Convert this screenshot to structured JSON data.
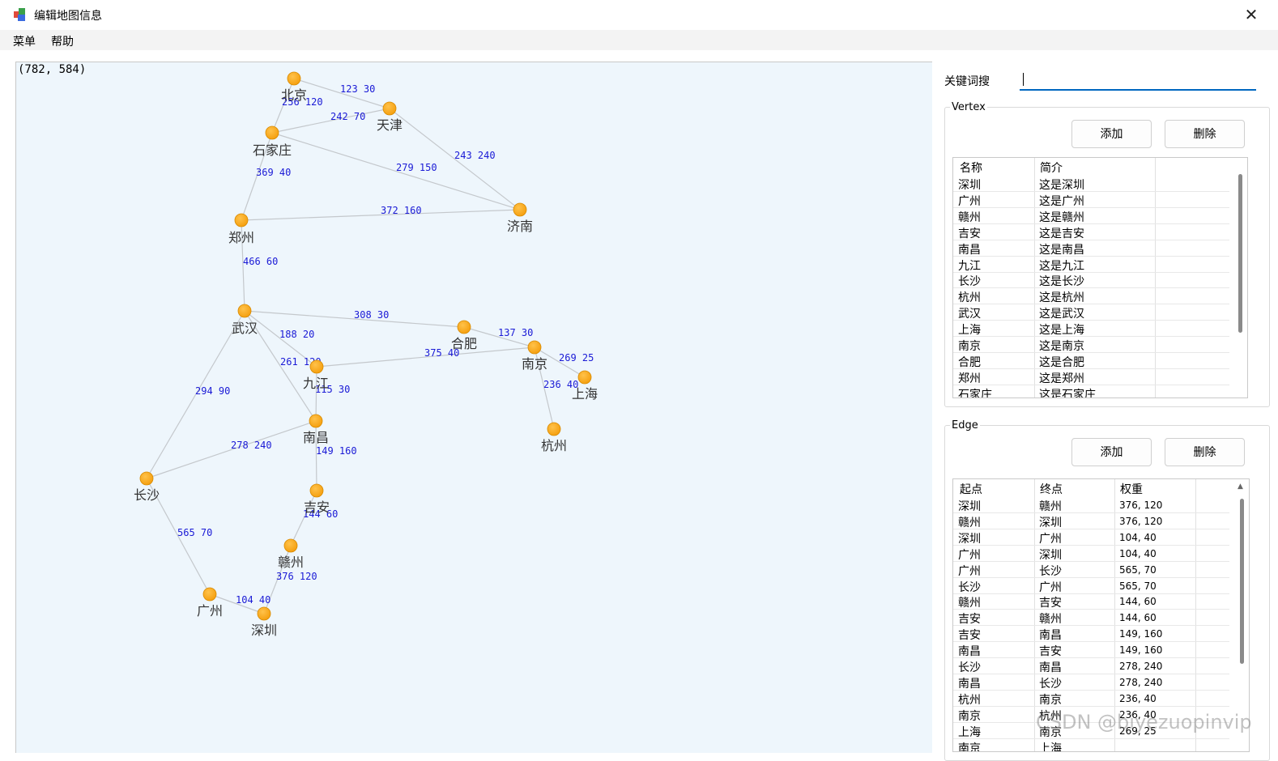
{
  "window": {
    "title": "编辑地图信息",
    "close_glyph": "✕"
  },
  "menu": [
    "菜单",
    "帮助"
  ],
  "canvas": {
    "coordinate_readout": "(782, 584)",
    "node_color": "#f5a010",
    "edge_label_color": "#1a1ad6",
    "vertices": [
      {
        "name": "北京"
      },
      {
        "name": "天津"
      },
      {
        "name": "石家庄"
      },
      {
        "name": "济南"
      },
      {
        "name": "郑州"
      },
      {
        "name": "武汉"
      },
      {
        "name": "合肥"
      },
      {
        "name": "南京"
      },
      {
        "name": "上海"
      },
      {
        "name": "九江"
      },
      {
        "name": "杭州"
      },
      {
        "name": "南昌"
      },
      {
        "name": "长沙"
      },
      {
        "name": "吉安"
      },
      {
        "name": "赣州"
      },
      {
        "name": "广州"
      },
      {
        "name": "深圳"
      }
    ],
    "edges": [
      {
        "from": "北京",
        "to": "天津",
        "label": "123 30"
      },
      {
        "from": "北京",
        "to": "石家庄",
        "label": "256 120"
      },
      {
        "from": "石家庄",
        "to": "天津",
        "label": "242 70"
      },
      {
        "from": "天津",
        "to": "济南",
        "label": "243 240"
      },
      {
        "from": "石家庄",
        "to": "济南",
        "label": "279 150"
      },
      {
        "from": "石家庄",
        "to": "郑州",
        "label": "369 40"
      },
      {
        "from": "郑州",
        "to": "济南",
        "label": "372 160"
      },
      {
        "from": "郑州",
        "to": "武汉",
        "label": "466 60"
      },
      {
        "from": "武汉",
        "to": "合肥",
        "label": "308 30"
      },
      {
        "from": "合肥",
        "to": "南京",
        "label": "137 30"
      },
      {
        "from": "武汉",
        "to": "九江",
        "label": "188 20"
      },
      {
        "from": "九江",
        "to": "南京",
        "label": "375 40"
      },
      {
        "from": "南京",
        "to": "上海",
        "label": "269 25"
      },
      {
        "from": "南京",
        "to": "杭州",
        "label": "236 40"
      },
      {
        "from": "武汉",
        "to": "南昌",
        "label": "261 120"
      },
      {
        "from": "九江",
        "to": "南昌",
        "label": "115 30"
      },
      {
        "from": "武汉",
        "to": "长沙",
        "label": "294 90"
      },
      {
        "from": "长沙",
        "to": "南昌",
        "label": "278 240"
      },
      {
        "from": "南昌",
        "to": "吉安",
        "label": "149 160"
      },
      {
        "from": "吉安",
        "to": "赣州",
        "label": "144 60"
      },
      {
        "from": "长沙",
        "to": "广州",
        "label": "565 70"
      },
      {
        "from": "赣州",
        "to": "深圳",
        "label": "376 120"
      },
      {
        "from": "广州",
        "to": "深圳",
        "label": "104 40"
      }
    ]
  },
  "search": {
    "label": "关键词搜",
    "value": ""
  },
  "vertex_panel": {
    "legend": "Vertex",
    "add_label": "添加",
    "delete_label": "删除",
    "columns": [
      "名称",
      "简介"
    ],
    "rows": [
      [
        "深圳",
        "这是深圳"
      ],
      [
        "广州",
        "这是广州"
      ],
      [
        "赣州",
        "这是赣州"
      ],
      [
        "吉安",
        "这是吉安"
      ],
      [
        "南昌",
        "这是南昌"
      ],
      [
        "九江",
        "这是九江"
      ],
      [
        "长沙",
        "这是长沙"
      ],
      [
        "杭州",
        "这是杭州"
      ],
      [
        "武汉",
        "这是武汉"
      ],
      [
        "上海",
        "这是上海"
      ],
      [
        "南京",
        "这是南京"
      ],
      [
        "合肥",
        "这是合肥"
      ],
      [
        "郑州",
        "这是郑州"
      ],
      [
        "石家庄",
        "这是石家庄"
      ]
    ]
  },
  "edge_panel": {
    "legend": "Edge",
    "add_label": "添加",
    "delete_label": "删除",
    "columns": [
      "起点",
      "终点",
      "权重"
    ],
    "rows": [
      [
        "深圳",
        "赣州",
        "376, 120"
      ],
      [
        "赣州",
        "深圳",
        "376, 120"
      ],
      [
        "深圳",
        "广州",
        "104, 40"
      ],
      [
        "广州",
        "深圳",
        "104, 40"
      ],
      [
        "广州",
        "长沙",
        "565, 70"
      ],
      [
        "长沙",
        "广州",
        "565, 70"
      ],
      [
        "赣州",
        "吉安",
        "144, 60"
      ],
      [
        "吉安",
        "赣州",
        "144, 60"
      ],
      [
        "吉安",
        "南昌",
        "149, 160"
      ],
      [
        "南昌",
        "吉安",
        "149, 160"
      ],
      [
        "长沙",
        "南昌",
        "278, 240"
      ],
      [
        "南昌",
        "长沙",
        "278, 240"
      ],
      [
        "杭州",
        "南京",
        "236, 40"
      ],
      [
        "南京",
        "杭州",
        "236, 40"
      ],
      [
        "上海",
        "南京",
        "269, 25"
      ],
      [
        "南京",
        "上海",
        ""
      ]
    ]
  },
  "watermark": "CSDN @biyezuopinvip"
}
